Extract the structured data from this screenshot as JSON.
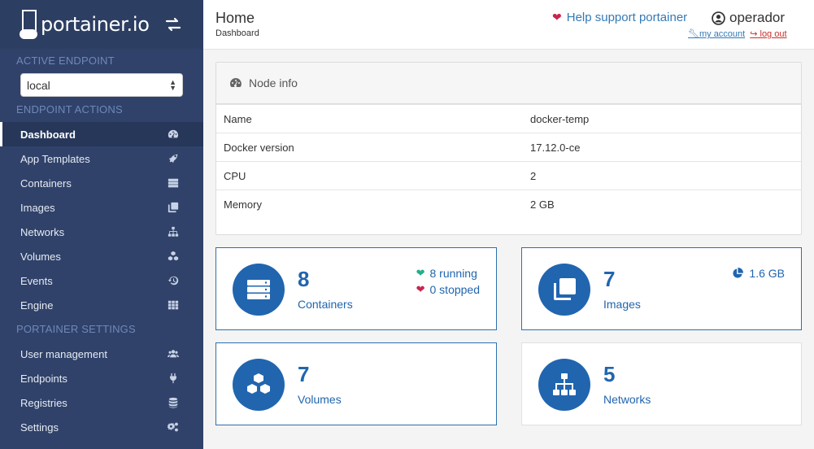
{
  "brand": {
    "name": "portainer.io"
  },
  "sidebar": {
    "active_endpoint_title": "ACTIVE ENDPOINT",
    "endpoint_value": "local",
    "endpoint_actions_title": "ENDPOINT ACTIONS",
    "actions": [
      {
        "label": "Dashboard",
        "icon": "tachometer-icon"
      },
      {
        "label": "App Templates",
        "icon": "rocket-icon"
      },
      {
        "label": "Containers",
        "icon": "server-icon"
      },
      {
        "label": "Images",
        "icon": "clone-icon"
      },
      {
        "label": "Networks",
        "icon": "sitemap-icon"
      },
      {
        "label": "Volumes",
        "icon": "cubes-icon"
      },
      {
        "label": "Events",
        "icon": "history-icon"
      },
      {
        "label": "Engine",
        "icon": "th-icon"
      }
    ],
    "settings_title": "PORTAINER SETTINGS",
    "settings": [
      {
        "label": "User management",
        "icon": "users-icon"
      },
      {
        "label": "Endpoints",
        "icon": "plug-icon"
      },
      {
        "label": "Registries",
        "icon": "database-icon"
      },
      {
        "label": "Settings",
        "icon": "cogs-icon"
      }
    ]
  },
  "header": {
    "title": "Home",
    "breadcrumb": "Dashboard",
    "help_link": "Help support portainer",
    "username": "operador",
    "my_account": "my account",
    "log_out": "log out"
  },
  "node_info": {
    "title": "Node info",
    "rows": [
      {
        "key": "Name",
        "value": "docker-temp"
      },
      {
        "key": "Docker version",
        "value": "17.12.0-ce"
      },
      {
        "key": "CPU",
        "value": "2"
      },
      {
        "key": "Memory",
        "value": "2 GB"
      }
    ]
  },
  "widgets": {
    "containers": {
      "count": "8",
      "label": "Containers",
      "running": "8 running",
      "stopped": "0 stopped"
    },
    "images": {
      "count": "7",
      "label": "Images",
      "size": "1.6 GB"
    },
    "volumes": {
      "count": "7",
      "label": "Volumes"
    },
    "networks": {
      "count": "5",
      "label": "Networks"
    }
  },
  "colors": {
    "sidebar_bg": "#30426a",
    "accent_blue": "#2165af",
    "running_green": "#23ae89",
    "stopped_red": "#c7254e"
  }
}
